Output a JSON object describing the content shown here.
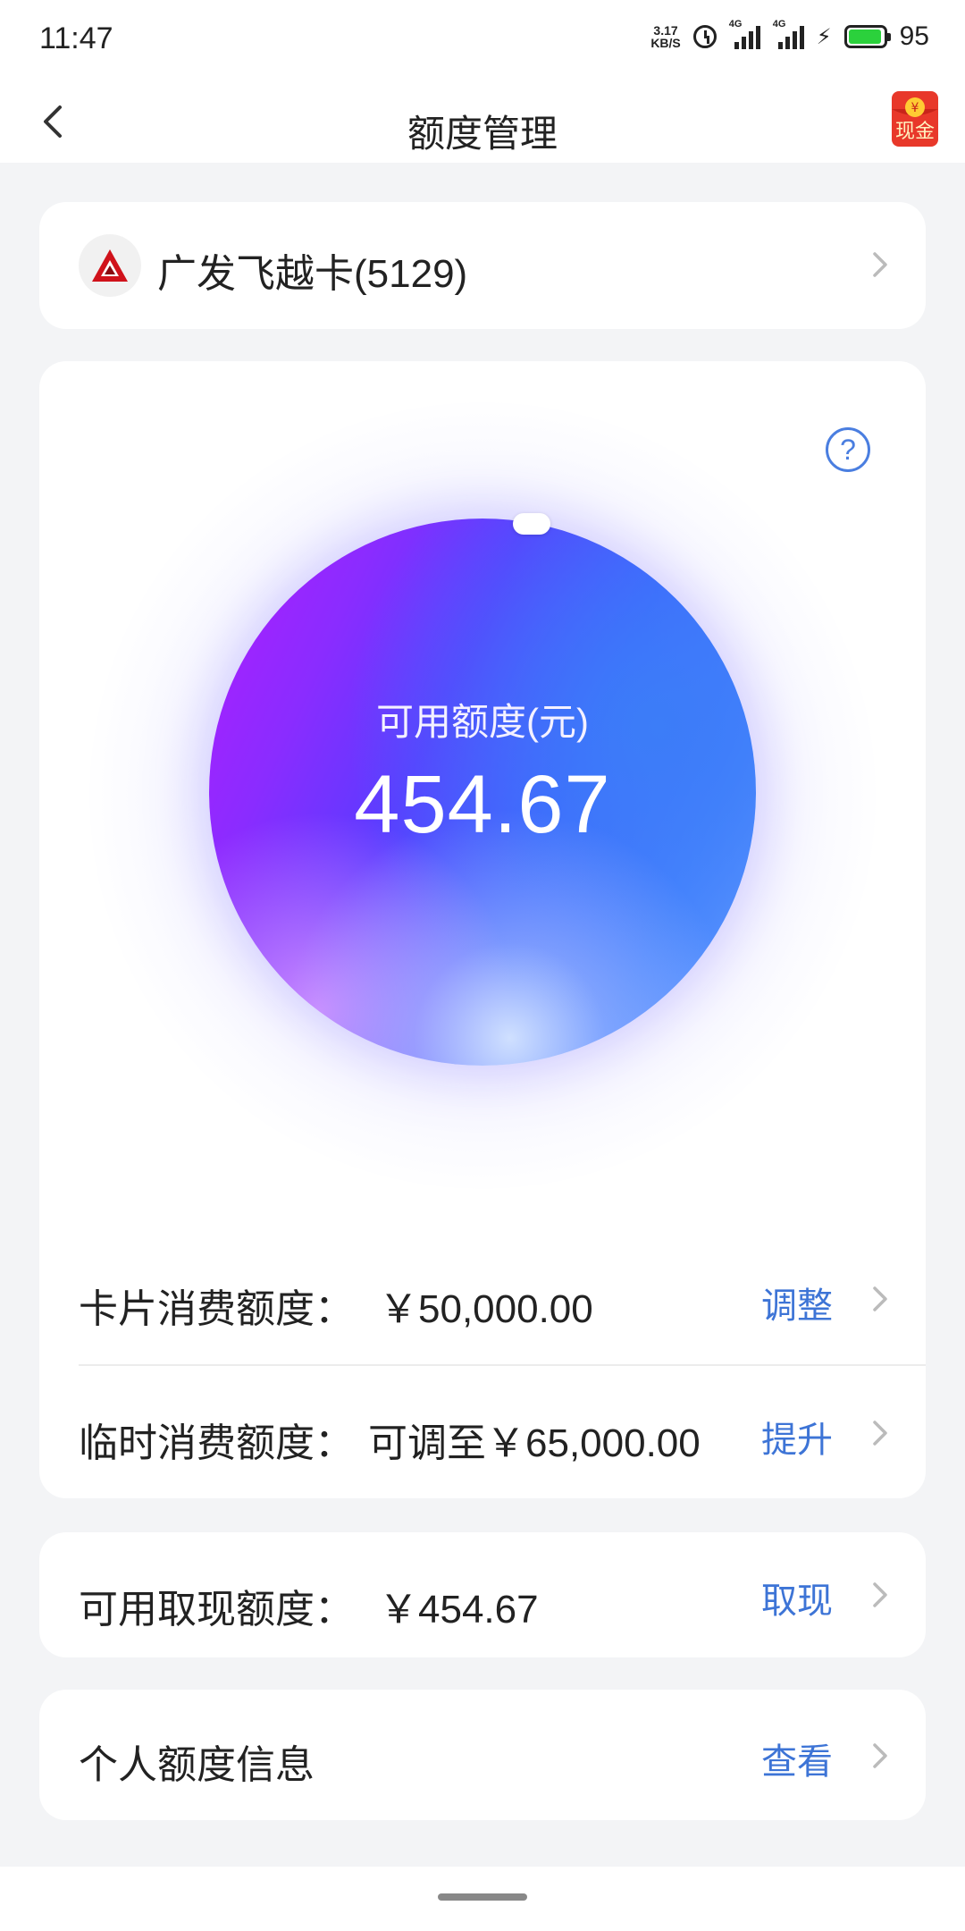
{
  "status_bar": {
    "time": "11:47",
    "net_speed_value": "3.17",
    "net_speed_unit": "KB/S",
    "sim1_label": "4G",
    "sim2_label": "4G",
    "battery_level": "95"
  },
  "nav": {
    "title": "额度管理",
    "cash_badge_symbol": "¥",
    "cash_badge_text": "现金"
  },
  "card_selector": {
    "card_name": "广发飞越卡(5129)"
  },
  "orb": {
    "label": "可用额度(元)",
    "value": "454.67",
    "help_symbol": "?"
  },
  "rows": {
    "consume": {
      "label": "卡片消费额度：",
      "value": "￥50,000.00",
      "action": "调整"
    },
    "temp": {
      "label": "临时消费额度：",
      "value": "可调至￥65,000.00",
      "action": "提升"
    },
    "cash": {
      "label": "可用取现额度：",
      "value": "￥454.67",
      "action": "取现"
    },
    "personal": {
      "label": "个人额度信息",
      "action": "查看"
    }
  },
  "colors": {
    "accent": "#3d74d6",
    "orb_purple": "#b21cff",
    "orb_blue": "#3f62ff",
    "brand_red": "#d0121b"
  }
}
